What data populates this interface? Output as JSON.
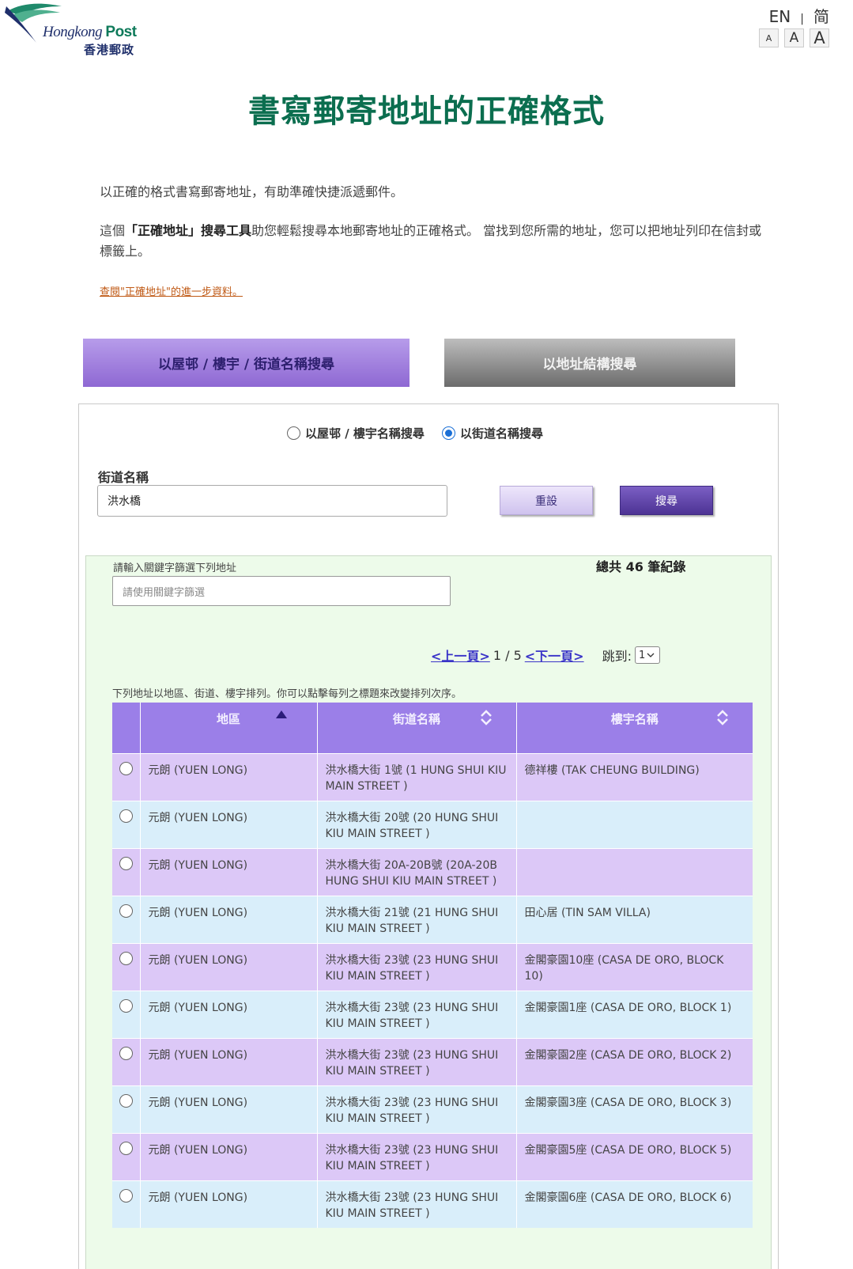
{
  "header": {
    "logo_en_part1": "Hongkong",
    "logo_en_part2": "Post",
    "logo_zh": "香港郵政",
    "lang_en": "EN",
    "lang_separator": "|",
    "lang_sc": "简",
    "font_small": "A",
    "font_medium": "A",
    "font_large": "A"
  },
  "title": "書寫郵寄地址的正確格式",
  "intro": {
    "p1": "以正確的格式書寫郵寄地址，有助準確快捷派遞郵件。",
    "p2_prefix": "這個",
    "p2_bold": "「正確地址」搜尋工具",
    "p2_suffix": "助您輕鬆搜尋本地郵寄地址的正確格式。 當找到您所需的地址，您可以把地址列印在信封或標籤上。",
    "more_link": "查閱\"正確地址\"的進一步資料。"
  },
  "tabs": {
    "active": "以屋邨 / 樓宇 / 街道名稱搜尋",
    "inactive": "以地址結構搜尋"
  },
  "search": {
    "radio_building": "以屋邨 / 樓宇名稱搜尋",
    "radio_street": "以街道名稱搜尋",
    "selected": "street",
    "street_label": "街道名稱",
    "street_value": "洪水橋",
    "reset_label": "重設",
    "search_label": "搜尋"
  },
  "results": {
    "filter_label": "請輸入關鍵字篩選下列地址",
    "filter_placeholder": "請使用關鍵字篩選",
    "total": "總共 46 筆紀錄",
    "prev": "<上一頁>",
    "page_info": "1 / 5",
    "next": "<下一頁>",
    "jump_label": "跳到:",
    "jump_value": "1",
    "sort_note": "下列地址以地區、街道、樓宇排列。你可以點擊每列之標題來改變排列次序。",
    "columns": [
      "地區",
      "街道名稱",
      "樓宇名稱"
    ],
    "rows": [
      {
        "district": "元朗 (YUEN LONG)",
        "street": "洪水橋大街 1號 (1 HUNG SHUI KIU MAIN STREET )",
        "building": "德祥樓 (TAK CHEUNG BUILDING)"
      },
      {
        "district": "元朗 (YUEN LONG)",
        "street": "洪水橋大街 20號 (20 HUNG SHUI KIU MAIN STREET )",
        "building": ""
      },
      {
        "district": "元朗 (YUEN LONG)",
        "street": "洪水橋大街 20A-20B號 (20A-20B HUNG SHUI KIU MAIN STREET )",
        "building": ""
      },
      {
        "district": "元朗 (YUEN LONG)",
        "street": "洪水橋大街 21號 (21 HUNG SHUI KIU MAIN STREET )",
        "building": "田心居 (TIN SAM VILLA)"
      },
      {
        "district": "元朗 (YUEN LONG)",
        "street": "洪水橋大街 23號 (23 HUNG SHUI KIU MAIN STREET )",
        "building": "金閣豪園10座 (CASA DE ORO, BLOCK 10)"
      },
      {
        "district": "元朗 (YUEN LONG)",
        "street": "洪水橋大街 23號 (23 HUNG SHUI KIU MAIN STREET )",
        "building": "金閣豪園1座 (CASA DE ORO, BLOCK 1)"
      },
      {
        "district": "元朗 (YUEN LONG)",
        "street": "洪水橋大街 23號 (23 HUNG SHUI KIU MAIN STREET )",
        "building": "金閣豪園2座 (CASA DE ORO, BLOCK 2)"
      },
      {
        "district": "元朗 (YUEN LONG)",
        "street": "洪水橋大街 23號 (23 HUNG SHUI KIU MAIN STREET )",
        "building": "金閣豪園3座 (CASA DE ORO, BLOCK 3)"
      },
      {
        "district": "元朗 (YUEN LONG)",
        "street": "洪水橋大街 23號 (23 HUNG SHUI KIU MAIN STREET )",
        "building": "金閣豪園5座 (CASA DE ORO, BLOCK 5)"
      },
      {
        "district": "元朗 (YUEN LONG)",
        "street": "洪水橋大街 23號 (23 HUNG SHUI KIU MAIN STREET )",
        "building": "金閣豪園6座 (CASA DE ORO, BLOCK 6)"
      }
    ]
  },
  "colors": {
    "title_green": "#0b6e4f",
    "tab_active": "#8e68d3",
    "header_purple": "#9b7fe8",
    "row_odd": "#dcc8f7",
    "row_even": "#d9eefa",
    "results_bg": "#edfbea",
    "link_blue": "#3a34c8"
  },
  "icons": {
    "logo": "hongkong-post-bird-icon",
    "sort_ascending": "triangle-up-icon",
    "sortable": "sort-updown-icon",
    "dropdown": "chevron-down-icon"
  }
}
